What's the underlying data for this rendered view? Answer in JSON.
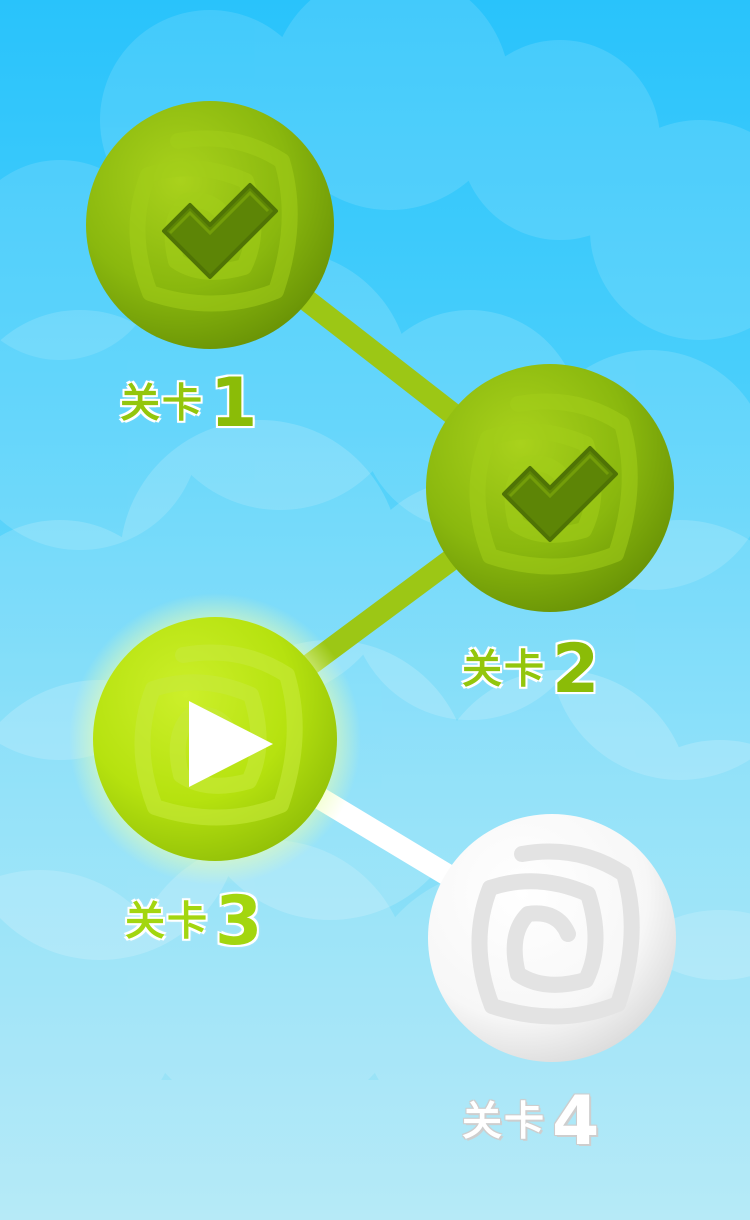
{
  "levels": [
    {
      "prefix": "关卡",
      "number": "1",
      "state": "completed",
      "icon": "checkmark-icon"
    },
    {
      "prefix": "关卡",
      "number": "2",
      "state": "completed",
      "icon": "checkmark-icon"
    },
    {
      "prefix": "关卡",
      "number": "3",
      "state": "current",
      "icon": "play-icon"
    },
    {
      "prefix": "关卡",
      "number": "4",
      "state": "locked",
      "icon": "spiral-icon"
    }
  ],
  "colors": {
    "sky_top": "#29c3fb",
    "sky_bottom": "#a8e6f6",
    "completed_green": "#8ab80e",
    "current_green": "#b6e20f",
    "locked_white": "#ffffff",
    "connector_completed": "#9cc715",
    "connector_locked": "#ffffff"
  }
}
